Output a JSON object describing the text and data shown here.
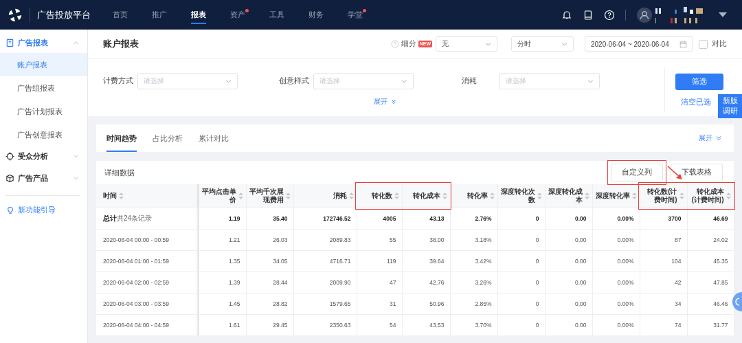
{
  "topbar": {
    "brand": "广告投放平台",
    "nav": [
      {
        "label": "首页",
        "selected": false,
        "dot": false
      },
      {
        "label": "推广",
        "selected": false,
        "dot": false
      },
      {
        "label": "报表",
        "selected": true,
        "dot": false
      },
      {
        "label": "资产",
        "selected": false,
        "dot": true
      },
      {
        "label": "工具",
        "selected": false,
        "dot": false
      },
      {
        "label": "财务",
        "selected": false,
        "dot": false
      },
      {
        "label": "学堂",
        "selected": false,
        "dot": true
      }
    ]
  },
  "sidebar": {
    "groups": [
      {
        "label": "广告报表",
        "expanded": true,
        "children": [
          {
            "label": "账户报表",
            "selected": true
          },
          {
            "label": "广告组报表",
            "selected": false
          },
          {
            "label": "广告计划报表",
            "selected": false
          },
          {
            "label": "广告创意报表",
            "selected": false
          }
        ]
      },
      {
        "label": "受众分析",
        "expanded": false
      },
      {
        "label": "广告产品",
        "expanded": false
      }
    ],
    "guide": "新功能引导"
  },
  "page": {
    "title": "账户报表",
    "breakdown_label": "细分",
    "new_badge": "NEW",
    "breakdown_value": "无",
    "granularity": "分时",
    "date_range": "2020-06-04 ~ 2020-06-04",
    "compare": {
      "label": "对比",
      "checked": false
    }
  },
  "filters": {
    "fields": [
      {
        "label": "计费方式",
        "placeholder": "请选择"
      },
      {
        "label": "创意样式",
        "placeholder": "请选择"
      },
      {
        "label": "消耗",
        "placeholder": "请选择"
      }
    ],
    "expand": "展开",
    "apply": "筛选",
    "clear": "清空已选"
  },
  "survey_tab": "新版调研",
  "tabs": [
    {
      "label": "时间趋势",
      "selected": true
    },
    {
      "label": "占比分析",
      "selected": false
    },
    {
      "label": "累计对比",
      "selected": false
    }
  ],
  "tabs_expand": "展开",
  "detail": {
    "title": "详细数据",
    "buttons": [
      {
        "label": "自定义列",
        "highlighted": true
      },
      {
        "label": "下载表格",
        "highlighted": false
      }
    ],
    "annotation_arrow": true,
    "table": {
      "columns": [
        {
          "label": "时间",
          "highlighted": false
        },
        {
          "label": "平均点击单价",
          "highlighted": false
        },
        {
          "label": "平均千次展现费用",
          "highlighted": false
        },
        {
          "label": "消耗",
          "highlighted": false
        },
        {
          "label": "转化数",
          "highlighted": true
        },
        {
          "label": "转化成本",
          "highlighted": true
        },
        {
          "label": "转化率",
          "highlighted": false
        },
        {
          "label": "深度转化次数",
          "highlighted": false
        },
        {
          "label": "深度转化成本",
          "highlighted": false
        },
        {
          "label": "深度转化率",
          "highlighted": false
        },
        {
          "label": "转化数(计费时间)",
          "highlighted": true
        },
        {
          "label": "转化成本(计费时间)",
          "highlighted": true
        }
      ],
      "total": {
        "label": "**总计**共24条记录",
        "cells": [
          "1.19",
          "35.40",
          "172746.52",
          "4005",
          "43.13",
          "2.76%",
          "0",
          "0.00",
          "0.00%",
          "3700",
          "46.69"
        ]
      },
      "rows": [
        [
          "2020-06-04 00:00 - 00:59",
          "1.21",
          "26.03",
          "2089.83",
          "55",
          "38.00",
          "3.18%",
          "0",
          "0.00",
          "0.00%",
          "87",
          "24.02"
        ],
        [
          "2020-06-04 01:00 - 01:59",
          "1.35",
          "34.05",
          "4716.71",
          "119",
          "39.64",
          "3.42%",
          "0",
          "0.00",
          "0.00%",
          "104",
          "45.35"
        ],
        [
          "2020-06-04 02:00 - 02:59",
          "1.39",
          "28.44",
          "2009.90",
          "47",
          "42.76",
          "3.26%",
          "0",
          "0.00",
          "0.00%",
          "42",
          "47.85"
        ],
        [
          "2020-06-04 03:00 - 03:59",
          "1.45",
          "28.82",
          "1579.65",
          "31",
          "50.96",
          "2.85%",
          "0",
          "0.00",
          "0.00%",
          "34",
          "46.46"
        ],
        [
          "2020-06-04 04:00 - 04:59",
          "1.61",
          "29.45",
          "2350.63",
          "54",
          "43.53",
          "3.70%",
          "0",
          "0.00",
          "0.00%",
          "74",
          "31.77"
        ]
      ]
    }
  }
}
